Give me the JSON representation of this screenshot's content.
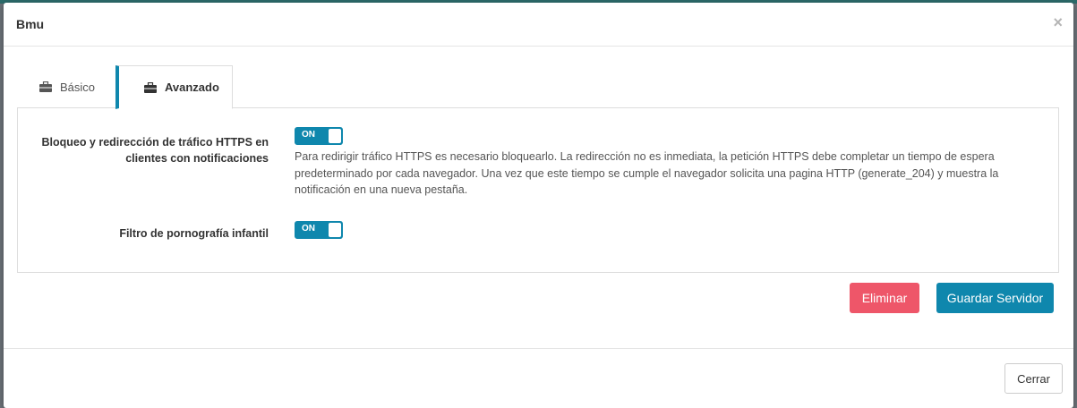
{
  "modal": {
    "title": "Bmu",
    "close_symbol": "×"
  },
  "tabs": [
    {
      "label": "Básico",
      "icon": "briefcase-icon",
      "active": false
    },
    {
      "label": "Avanzado",
      "icon": "briefcase-icon",
      "active": true
    }
  ],
  "settings": {
    "https_block": {
      "label": "Bloqueo y redirección de tráfico HTTPS en clientes con notificaciones",
      "toggle_state": "ON",
      "help": "Para redirigir tráfico HTTPS es necesario bloquearlo. La redirección no es inmediata, la petición HTTPS debe completar un tiempo de espera predeterminado por cada navegador. Una vez que este tiempo se cumple el navegador solicita una pagina HTTP (generate_204) y muestra la notificación en una nueva pestaña."
    },
    "child_filter": {
      "label": "Filtro de pornografía infantil",
      "toggle_state": "ON"
    }
  },
  "actions": {
    "delete_label": "Eliminar",
    "save_label": "Guardar Servidor"
  },
  "footer": {
    "close_label": "Cerrar"
  },
  "colors": {
    "accent": "#0f87ad",
    "danger": "#ee5669"
  }
}
